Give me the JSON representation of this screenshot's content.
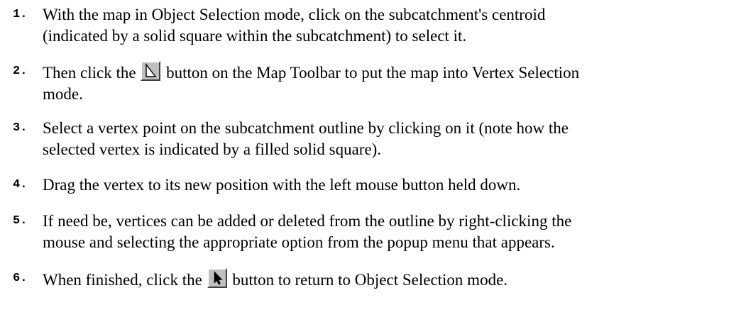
{
  "steps": [
    {
      "number": "1.",
      "line1": "With the map in Object Selection mode, click on the subcatchment's centroid",
      "line2": "(indicated by a solid square within the subcatchment) to select it."
    },
    {
      "number": "2.",
      "before": "Then click the",
      "icon": "vertex-select-icon",
      "after": "button on the Map Toolbar to put the map into Vertex Selection",
      "line2": "mode."
    },
    {
      "number": "3.",
      "line1": "Select a vertex point on the subcatchment outline by clicking on it (note how the",
      "line2": "selected vertex is indicated by a filled solid square)."
    },
    {
      "number": "4.",
      "line1": "Drag the vertex to its new position with the left mouse button held down."
    },
    {
      "number": "5.",
      "line1": "If need be, vertices can be added or deleted from the outline by right-clicking the",
      "line2": "mouse and selecting the appropriate option from the popup menu that appears."
    },
    {
      "number": "6.",
      "before": "When finished, click the",
      "icon": "object-select-icon",
      "after": "button to return to Object Selection mode."
    }
  ]
}
